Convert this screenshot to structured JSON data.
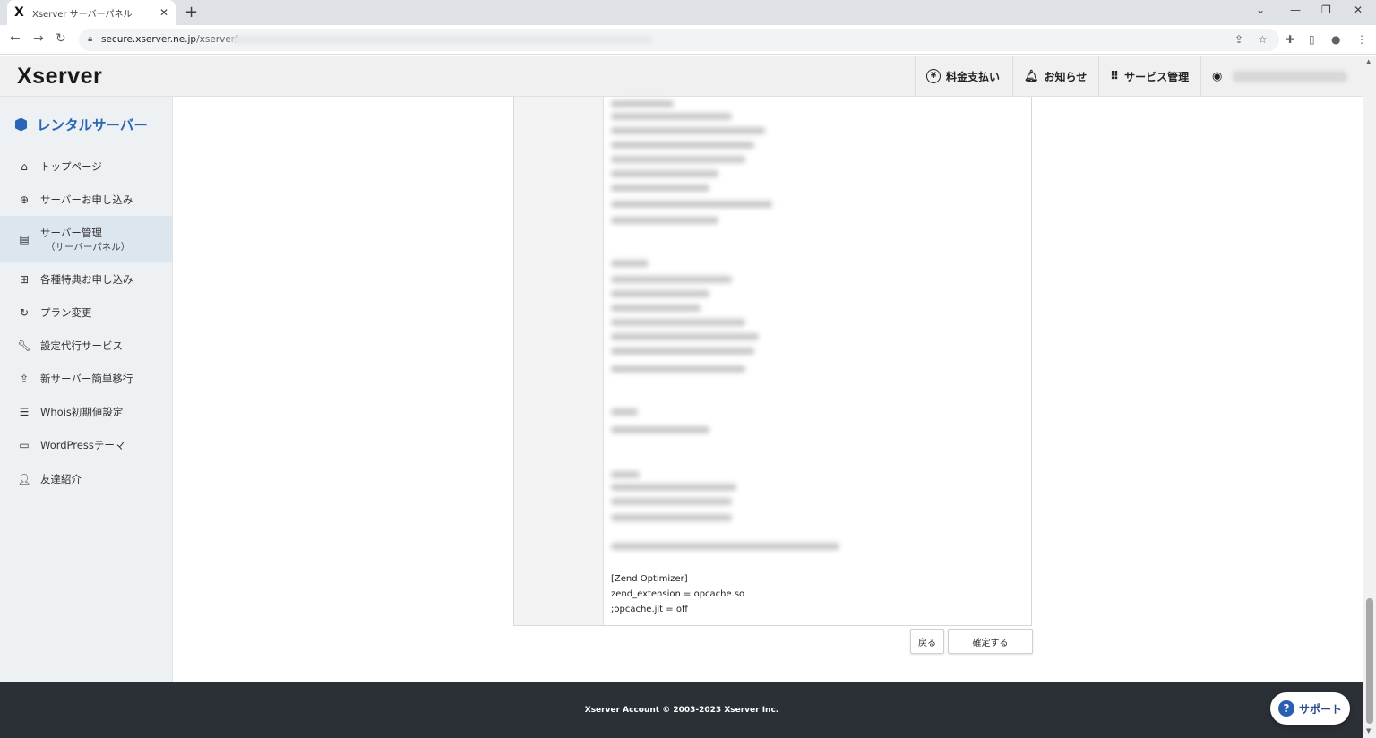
{
  "browser": {
    "tab_title": "Xserver サーバーパネル",
    "tab_favicon": "X",
    "new_tab": "+",
    "url_host": "secure.xserver.ne.jp",
    "url_path": "/xserver/"
  },
  "header": {
    "logo": "Xserver",
    "nav": [
      {
        "label": "料金支払い",
        "icon": "yen-icon"
      },
      {
        "label": "お知らせ",
        "icon": "bell-icon"
      },
      {
        "label": "サービス管理",
        "icon": "grid-icon"
      }
    ]
  },
  "sidebar": {
    "title": "レンタルサーバー",
    "items": [
      {
        "label": "トップページ",
        "icon": "home-icon"
      },
      {
        "label": "サーバーお申し込み",
        "icon": "plus-circle-icon"
      },
      {
        "label": "サーバー管理",
        "sub": "（サーバーパネル）",
        "icon": "server-icon"
      },
      {
        "label": "各種特典お申し込み",
        "icon": "gift-icon"
      },
      {
        "label": "プラン変更",
        "icon": "refresh-icon"
      },
      {
        "label": "設定代行サービス",
        "icon": "wrench-icon"
      },
      {
        "label": "新サーバー簡単移行",
        "icon": "upload-icon"
      },
      {
        "label": "Whois初期値設定",
        "icon": "document-icon"
      },
      {
        "label": "WordPressテーマ",
        "icon": "window-icon"
      },
      {
        "label": "友達紹介",
        "icon": "person-icon"
      }
    ]
  },
  "content": {
    "code_lines": [
      "[Zend Optimizer]",
      "zend_extension = opcache.so",
      ";opcache.jit = off"
    ],
    "back_button": "戻る",
    "confirm_button": "確定する"
  },
  "footer": {
    "copyright": "Xserver Account © 2003-2023 Xserver Inc."
  },
  "support_button": "サポート"
}
